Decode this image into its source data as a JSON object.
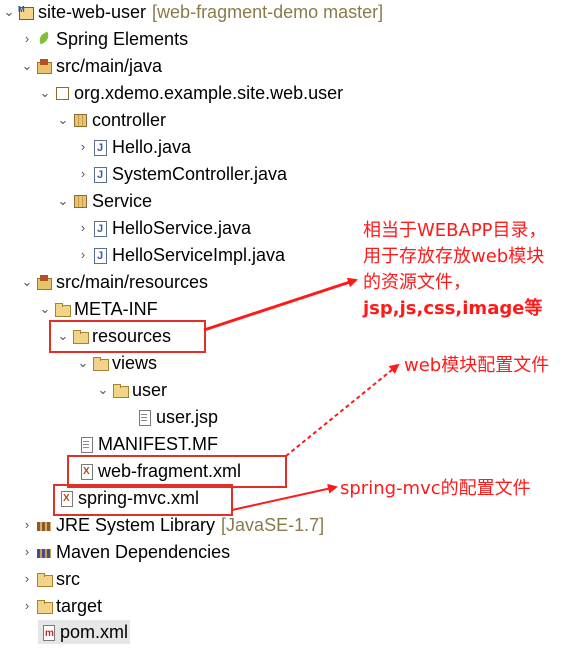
{
  "tree": {
    "project": {
      "label": "site-web-user",
      "decoration": "[web-fragment-demo master]"
    },
    "spring_elements": "Spring Elements",
    "src_main_java": "src/main/java",
    "package_user": "org.xdemo.example.site.web.user",
    "pkg_controller": "controller",
    "hello_java": "Hello.java",
    "system_controller": "SystemController.java",
    "pkg_service": "Service",
    "hello_service": "HelloService.java",
    "hello_service_impl": "HelloServiceImpl.java",
    "src_main_resources": "src/main/resources",
    "meta_inf": "META-INF",
    "resources": "resources",
    "views": "views",
    "user_folder": "user",
    "user_jsp": "user.jsp",
    "manifest": "MANIFEST.MF",
    "web_fragment": "web-fragment.xml",
    "spring_mvc": "spring-mvc.xml",
    "jre": {
      "label": "JRE System Library",
      "decoration": "[JavaSE-1.7]"
    },
    "maven_deps": "Maven Dependencies",
    "src": "src",
    "target": "target",
    "pom": "pom.xml"
  },
  "annotations": {
    "resources_note": [
      "相当于WEBAPP目录，",
      "用于存放存放web模块",
      "的资源文件，",
      "jsp,js,css,image等"
    ],
    "fragment_note": "web模块配置文件",
    "mvc_note": "spring-mvc的配置文件"
  },
  "colors": {
    "annotation": "#ff1a1a",
    "decoration": "#8a7a4a"
  },
  "icons": [
    "project-icon",
    "spring-leaf-icon",
    "source-folder-icon",
    "package-icon",
    "java-file-icon",
    "folder-icon",
    "file-icon",
    "xml-file-icon",
    "library-icon",
    "pom-file-icon",
    "chevron-down-icon",
    "chevron-right-icon"
  ]
}
